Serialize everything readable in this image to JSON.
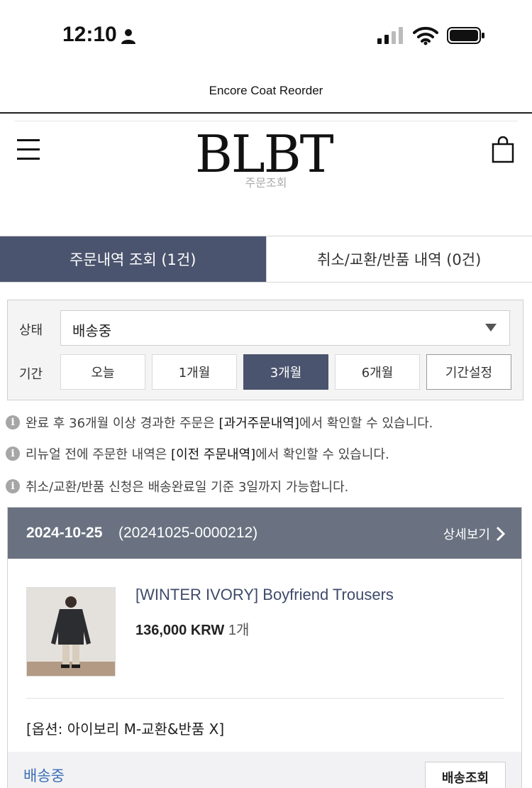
{
  "status_bar": {
    "time": "12:10",
    "icons": [
      "person-icon",
      "signal-icon",
      "wifi-icon",
      "battery-icon"
    ]
  },
  "app": {
    "title": "Encore Coat Reorder"
  },
  "header": {
    "logo_text": "BLBT",
    "page_subtitle": "주문조회",
    "icons": [
      "menu-icon",
      "cart-icon"
    ]
  },
  "tabs": [
    {
      "label": "주문내역 조회 (1건)",
      "active": true
    },
    {
      "label": "취소/교환/반품 내역 (0건)",
      "active": false
    }
  ],
  "filter": {
    "status_label": "상태",
    "status_value": "배송중",
    "period_label": "기간",
    "periods": [
      "오늘",
      "1개월",
      "3개월",
      "6개월",
      "기간설정"
    ],
    "selected_period": "3개월"
  },
  "notices": [
    {
      "before": "완료 후 36개월 이상 경과한 주문은 ",
      "highlight": "[과거주문내역]",
      "after": "에서 확인할 수 있습니다."
    },
    {
      "before": "리뉴얼 전에 주문한 내역은 ",
      "highlight": "[이전 주문내역]",
      "after": "에서 확인할 수 있습니다."
    },
    {
      "before": "취소/교환/반품 신청은 배송완료일 기준 3일까지 가능합니다.",
      "highlight": "",
      "after": ""
    }
  ],
  "order": {
    "date": "2024-10-25",
    "number": "(20241025-0000212)",
    "detail_label": "상세보기",
    "product_name": "[WINTER IVORY] Boyfriend Trousers",
    "price": "136,000 KRW",
    "quantity": "1개",
    "option": "[옵션: 아이보리 M-교환&반품 X]",
    "status": "배송중",
    "track_label": "배송조회"
  },
  "colors": {
    "accent_navy": "#4b546e",
    "order_header": "#6a7180",
    "product_link": "#3e4a6b",
    "status_blue": "#3b6fb6"
  }
}
